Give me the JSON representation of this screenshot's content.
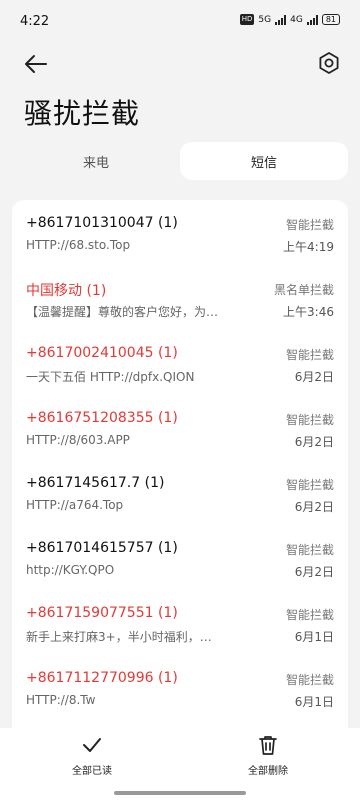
{
  "status": {
    "time": "4:22",
    "hd": "HD",
    "net1": "5G",
    "net2": "4G",
    "battery": "81"
  },
  "header": {
    "back_icon": "arrow-left-icon",
    "settings_icon": "gear-icon"
  },
  "title": "骚扰拦截",
  "tabs": [
    {
      "label": "来电"
    },
    {
      "label": "短信"
    }
  ],
  "messages": [
    {
      "sender": "+8617101310047 (1)",
      "snippet": "HTTP://68.sto.Top",
      "type": "智能拦截",
      "time": "上午4:19",
      "sender_color": "#111111"
    },
    {
      "sender": "中国移动 (1)",
      "snippet": "【温馨提醒】尊敬的客户您好，为…",
      "type": "黑名单拦截",
      "time": "上午3:46",
      "sender_color": "#e53935"
    },
    {
      "sender": "+8617002410045 (1)",
      "snippet": "一天下五佰 HTTP://dpfx.QION",
      "type": "智能拦截",
      "time": "6月2日",
      "sender_color": "#e53935"
    },
    {
      "sender": "+8616751208355 (1)",
      "snippet": "HTTP://8/603.APP",
      "type": "智能拦截",
      "time": "6月2日",
      "sender_color": "#e53935"
    },
    {
      "sender": "+8617145617.7 (1)",
      "snippet": "HTTP://a764.Top",
      "type": "智能拦截",
      "time": "6月2日",
      "sender_color": "#111111"
    },
    {
      "sender": "+8617014615757 (1)",
      "snippet": "http://KGY.QPO",
      "type": "智能拦截",
      "time": "6月2日",
      "sender_color": "#111111"
    },
    {
      "sender": "+8617159077551 (1)",
      "snippet": "新手上来打麻3+，半小时福利，…",
      "type": "智能拦截",
      "time": "6月1日",
      "sender_color": "#e53935"
    },
    {
      "sender": "+8617112770996 (1)",
      "snippet": "HTTP://8.Tw",
      "type": "智能拦截",
      "time": "6月1日",
      "sender_color": "#e53935"
    }
  ],
  "bottom": {
    "mark_read": {
      "label": "全部已读",
      "icon": "check-icon"
    },
    "delete_all": {
      "label": "全部删除",
      "icon": "trash-icon"
    }
  }
}
